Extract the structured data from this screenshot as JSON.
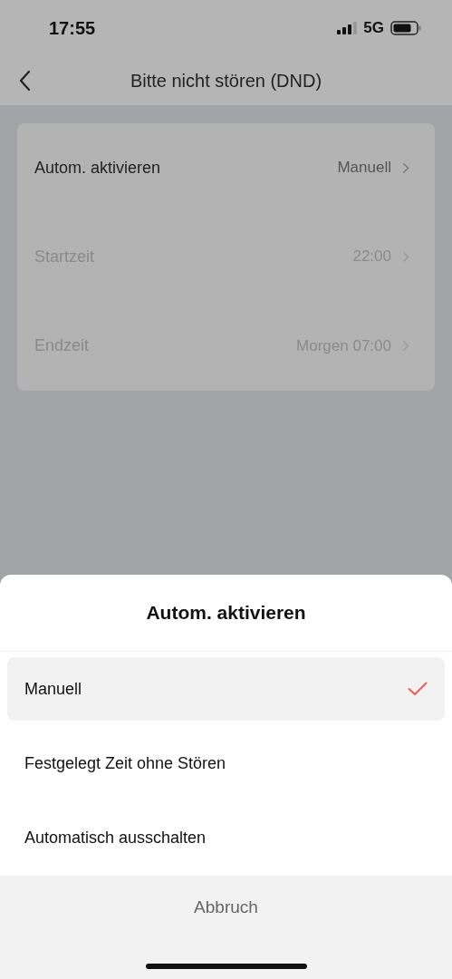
{
  "status_bar": {
    "time": "17:55",
    "network": "5G"
  },
  "nav": {
    "title": "Bitte nicht stören (DND)"
  },
  "settings": [
    {
      "label": "Autom. aktivieren",
      "value": "Manuell",
      "disabled": false
    },
    {
      "label": "Startzeit",
      "value": "22:00",
      "disabled": true
    },
    {
      "label": "Endzeit",
      "value": "Morgen 07:00",
      "disabled": true
    }
  ],
  "sheet": {
    "title": "Autom. aktivieren",
    "options": [
      {
        "label": "Manuell",
        "selected": true
      },
      {
        "label": "Festgelegt Zeit ohne Stören",
        "selected": false
      },
      {
        "label": "Automatisch ausschalten",
        "selected": false
      }
    ],
    "cancel": "Abbruch"
  }
}
